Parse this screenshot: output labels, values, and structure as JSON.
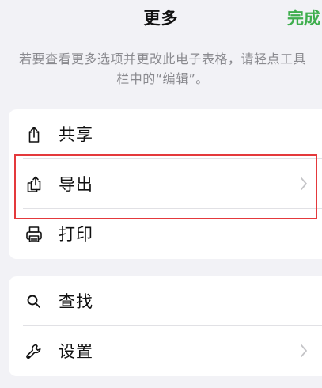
{
  "nav": {
    "title": "更多",
    "done_label": "完成",
    "done_color": "#3fae4e"
  },
  "hint": "若要查看更多选项并更改此电子表格，请轻点工具栏中的“编辑”。",
  "sections": [
    {
      "items": [
        {
          "label": "共享",
          "icon": "share-icon"
        },
        {
          "label": "导出",
          "icon": "export-icon",
          "chevron": true
        },
        {
          "label": "打印",
          "icon": "printer-icon"
        }
      ]
    },
    {
      "items": [
        {
          "label": "查找",
          "icon": "search-icon"
        },
        {
          "label": "设置",
          "icon": "wrench-icon",
          "chevron": true
        }
      ]
    }
  ],
  "highlight_color": "#e4393c"
}
